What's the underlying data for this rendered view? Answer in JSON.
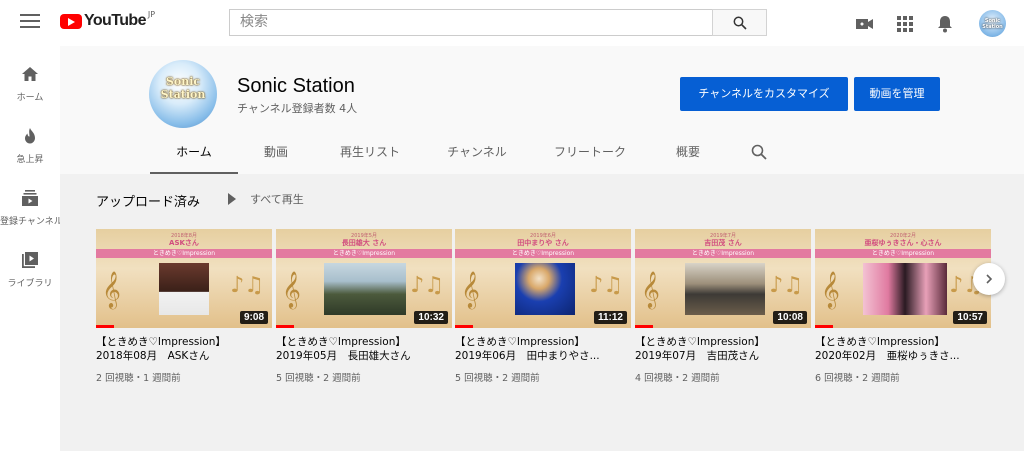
{
  "topbar": {
    "logo_text": "YouTube",
    "logo_region": "JP",
    "search_placeholder": "検索"
  },
  "user_avatar_text": "Sonic Station",
  "sidebar": {
    "items": [
      {
        "label": "ホーム",
        "icon": "home-icon"
      },
      {
        "label": "急上昇",
        "icon": "trending-icon"
      },
      {
        "label": "登録チャンネル",
        "icon": "subscriptions-icon"
      },
      {
        "label": "ライブラリ",
        "icon": "library-icon"
      }
    ]
  },
  "channel": {
    "avatar_text": "Sonic Station",
    "title": "Sonic Station",
    "subscribers": "チャンネル登録者数 4人",
    "customize_label": "チャンネルをカスタマイズ",
    "manage_label": "動画を管理",
    "tabs": [
      {
        "label": "ホーム"
      },
      {
        "label": "動画"
      },
      {
        "label": "再生リスト"
      },
      {
        "label": "チャンネル"
      },
      {
        "label": "フリートーク"
      },
      {
        "label": "概要"
      }
    ]
  },
  "shelf": {
    "title": "アップロード済み",
    "play_all": "すべて再生",
    "videos": [
      {
        "thumb_date": "2018年8月",
        "thumb_name": "ASKさん",
        "duration": "9:08",
        "title": "【ときめき♡Impression】\n2018年08月　ASKさん",
        "meta": "2 回視聴・1 週間前",
        "progress": 0.1
      },
      {
        "thumb_date": "2019年5月",
        "thumb_name": "長田雄大 さん",
        "duration": "10:32",
        "title": "【ときめき♡Impression】\n2019年05月　長田雄大さん",
        "meta": "5 回視聴・2 週間前",
        "progress": 0.1
      },
      {
        "thumb_date": "2019年6月",
        "thumb_name": "田中まりや さん",
        "duration": "11:12",
        "title": "【ときめき♡Impression】\n2019年06月　田中まりやさ...",
        "meta": "5 回視聴・2 週間前",
        "progress": 0.1
      },
      {
        "thumb_date": "2019年7月",
        "thumb_name": "吉田茂 さん",
        "duration": "10:08",
        "title": "【ときめき♡Impression】\n2019年07月　吉田茂さん",
        "meta": "4 回視聴・2 週間前",
        "progress": 0.1
      },
      {
        "thumb_date": "2020年2月",
        "thumb_name": "亜桜ゆぅきさん・心さん",
        "duration": "10:57",
        "title": "【ときめき♡Impression】\n2020年02月　亜桜ゆぅきさ...",
        "meta": "6 回視聴・2 週間前",
        "progress": 0.1
      }
    ]
  },
  "thumb_band_text": "ときめき♡Impression",
  "colors": {
    "brand_red": "#ff0000",
    "button_blue": "#065fd4",
    "thumb_pink": "#e37aa0"
  }
}
